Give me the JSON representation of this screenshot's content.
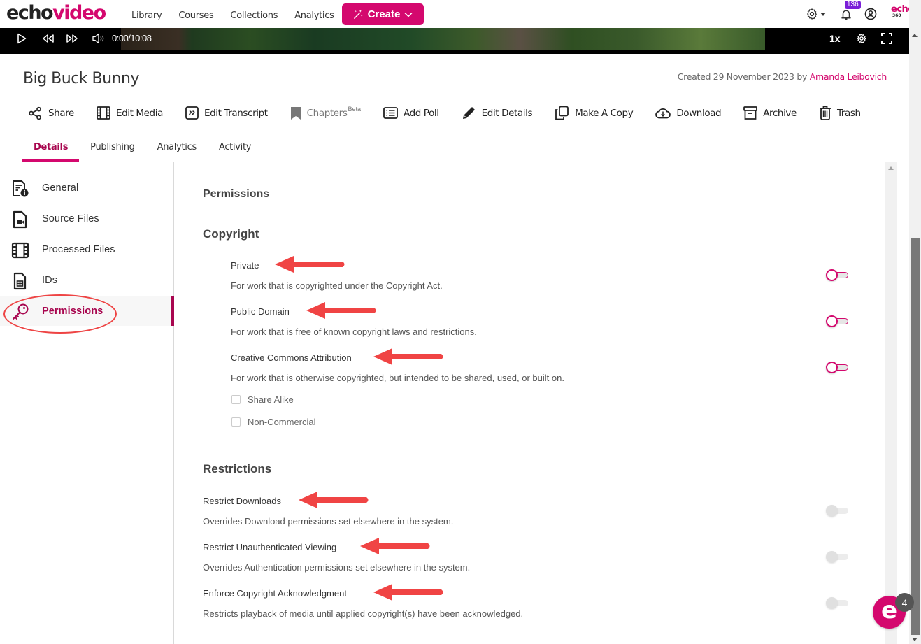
{
  "app": {
    "logo_part1": "echo",
    "logo_part2": "video",
    "brand_color": "#d4086e"
  },
  "nav": {
    "links": [
      "Library",
      "Courses",
      "Collections",
      "Analytics"
    ],
    "create_label": "Create",
    "notification_count": "136",
    "echo360_logo": "echo",
    "echo360_sub": "360"
  },
  "player": {
    "time": "0:00/10:08",
    "speed": "1x"
  },
  "media": {
    "title": "Big Buck Bunny",
    "created_prefix": "Created 29 November 2023 by ",
    "author": "Amanda Leibovich"
  },
  "actions": [
    {
      "label": "Share",
      "icon": "share-icon"
    },
    {
      "label": "Edit Media",
      "icon": "film-icon"
    },
    {
      "label": "Edit Transcript",
      "icon": "quote-icon"
    },
    {
      "label": "Chapters",
      "icon": "bookmark-icon",
      "sup": "Beta",
      "disabled": true
    },
    {
      "label": "Add Poll",
      "icon": "list-icon"
    },
    {
      "label": "Edit Details",
      "icon": "pencil-icon"
    },
    {
      "label": "Make A Copy",
      "icon": "copy-icon"
    },
    {
      "label": "Download",
      "icon": "cloud-download-icon"
    },
    {
      "label": "Archive",
      "icon": "archive-icon"
    },
    {
      "label": "Trash",
      "icon": "trash-icon"
    }
  ],
  "tabs": [
    {
      "label": "Details",
      "active": true
    },
    {
      "label": "Publishing"
    },
    {
      "label": "Analytics"
    },
    {
      "label": "Activity"
    }
  ],
  "sidebar": {
    "items": [
      {
        "label": "General",
        "icon": "document-info-icon"
      },
      {
        "label": "Source Files",
        "icon": "video-file-icon"
      },
      {
        "label": "Processed Files",
        "icon": "film-icon"
      },
      {
        "label": "IDs",
        "icon": "id-file-icon"
      },
      {
        "label": "Permissions",
        "icon": "key-icon",
        "active": true
      }
    ]
  },
  "permissions": {
    "heading": "Permissions",
    "copyright": {
      "heading": "Copyright",
      "options": [
        {
          "title": "Private",
          "desc": "For work that is copyrighted under the Copyright Act.",
          "enabled": false
        },
        {
          "title": "Public Domain",
          "desc": "For work that is free of known copyright laws and restrictions.",
          "enabled": false
        },
        {
          "title": "Creative Commons Attribution",
          "desc": "For work that is otherwise copyrighted, but intended to be shared, used, or built on.",
          "enabled": false
        }
      ],
      "checkboxes": [
        {
          "label": "Share Alike",
          "checked": false
        },
        {
          "label": "Non-Commercial",
          "checked": false
        }
      ]
    },
    "restrictions": {
      "heading": "Restrictions",
      "options": [
        {
          "title": "Restrict Downloads",
          "desc": "Overrides Download permissions set elsewhere in the system.",
          "enabled": false,
          "disabled": true
        },
        {
          "title": "Restrict Unauthenticated Viewing",
          "desc": "Overrides Authentication permissions set elsewhere in the system.",
          "enabled": false,
          "disabled": true
        },
        {
          "title": "Enforce Copyright Acknowledgment",
          "desc": "Restricts playback of media until applied copyright(s) have been acknowledged.",
          "enabled": false,
          "disabled": true
        }
      ]
    }
  },
  "chat_widget": {
    "letter": "e",
    "badge": "4"
  },
  "annotation_color": "#f04444"
}
